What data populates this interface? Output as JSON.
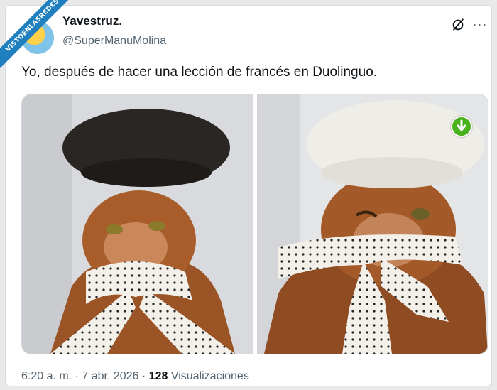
{
  "watermark": "VISTOENLASREDES",
  "tweet": {
    "display_name": "Yavestruz.",
    "handle": "@SuperManuMolina",
    "text": "Yo, después de hacer una lección de francés en Duolinguo.",
    "time": "6:20 a. m.",
    "separator1": " · ",
    "date": "7 abr. 2026",
    "separator2": " · ",
    "views_count": "128",
    "views_label": " Visualizaciones"
  },
  "icons": {
    "grok": "grok-icon",
    "more": "more-icon",
    "download": "download-icon"
  },
  "colors": {
    "text": "#0f1419",
    "secondary": "#536471",
    "badge": "#1f7fbf",
    "download": "#4ab21e"
  }
}
